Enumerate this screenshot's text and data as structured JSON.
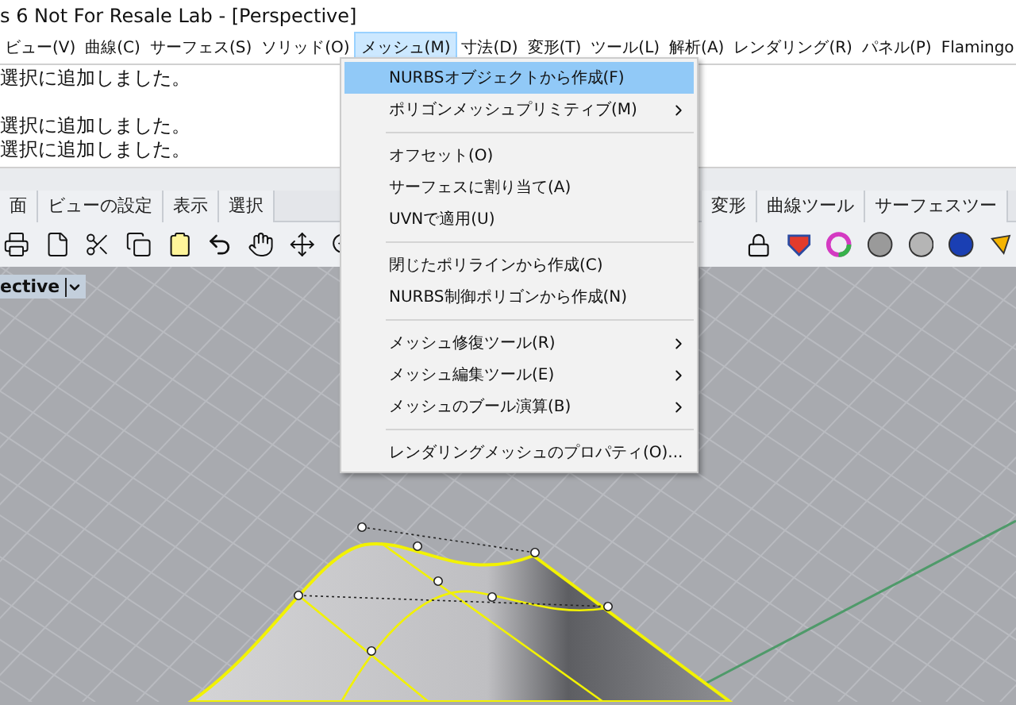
{
  "window": {
    "title": "s 6 Not For Resale Lab - [Perspective]"
  },
  "menu_bar": [
    {
      "label": "ビュー(V)",
      "selected": false
    },
    {
      "label": "曲線(C)",
      "selected": false
    },
    {
      "label": "サーフェス(S)",
      "selected": false
    },
    {
      "label": "ソリッド(O)",
      "selected": false
    },
    {
      "label": "メッシュ(M)",
      "selected": true
    },
    {
      "label": "寸法(D)",
      "selected": false
    },
    {
      "label": "変形(T)",
      "selected": false
    },
    {
      "label": "ツール(L)",
      "selected": false
    },
    {
      "label": "解析(A)",
      "selected": false
    },
    {
      "label": "レンダリング(R)",
      "selected": false
    },
    {
      "label": "パネル(P)",
      "selected": false
    },
    {
      "label": "Flamingo",
      "selected": false
    }
  ],
  "command_history": [
    {
      "text": "選択に追加しました。",
      "gap_before": false
    },
    {
      "text": "選択に追加しました。",
      "gap_before": true
    },
    {
      "text": "選択に追加しました。",
      "gap_before": false
    }
  ],
  "toolbar_tabs_left": [
    {
      "label": "面",
      "selected": false
    },
    {
      "label": "ビューの設定",
      "selected": false
    },
    {
      "label": "表示",
      "selected": false
    },
    {
      "label": "選択",
      "selected": false
    }
  ],
  "toolbar_tabs_right": [
    {
      "label": "変形",
      "selected": false
    },
    {
      "label": "曲線ツール",
      "selected": false
    },
    {
      "label": "サーフェスツー",
      "selected": false
    }
  ],
  "viewport": {
    "label": "ective"
  },
  "dropdown_menu": [
    {
      "kind": "item",
      "label": "NURBSオブジェクトから作成(F)",
      "selected": true,
      "submenu": false
    },
    {
      "kind": "item",
      "label": "ポリゴンメッシュプリミティブ(M)",
      "selected": false,
      "submenu": true
    },
    {
      "kind": "separator"
    },
    {
      "kind": "item",
      "label": "オフセット(O)",
      "selected": false,
      "submenu": false
    },
    {
      "kind": "item",
      "label": "サーフェスに割り当て(A)",
      "selected": false,
      "submenu": false
    },
    {
      "kind": "item",
      "label": "UVNで適用(U)",
      "selected": false,
      "submenu": false
    },
    {
      "kind": "separator"
    },
    {
      "kind": "item",
      "label": "閉じたポリラインから作成(C)",
      "selected": false,
      "submenu": false
    },
    {
      "kind": "item",
      "label": "NURBS制御ポリゴンから作成(N)",
      "selected": false,
      "submenu": false
    },
    {
      "kind": "separator"
    },
    {
      "kind": "item",
      "label": "メッシュ修復ツール(R)",
      "selected": false,
      "submenu": true
    },
    {
      "kind": "item",
      "label": "メッシュ編集ツール(E)",
      "selected": false,
      "submenu": true
    },
    {
      "kind": "item",
      "label": "メッシュのブール演算(B)",
      "selected": false,
      "submenu": true
    },
    {
      "kind": "separator"
    },
    {
      "kind": "item",
      "label": "レンダリングメッシュのプロパティ(O)...",
      "selected": false,
      "submenu": false
    }
  ]
}
